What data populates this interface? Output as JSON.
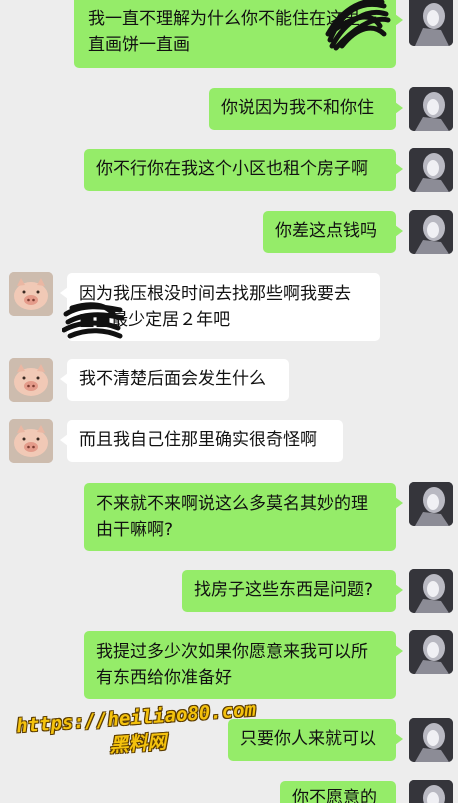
{
  "messages": [
    {
      "side": "me",
      "text": "我一直不理解为什么你不能住在这里一直画饼一直画"
    },
    {
      "side": "me",
      "text": "你说因为我不和你住"
    },
    {
      "side": "me",
      "text": "你不行你在我这个小区也租个房子啊"
    },
    {
      "side": "me",
      "text": "你差这点钱吗"
    },
    {
      "side": "other",
      "text": "因为我压根没时间去找那些啊我要去■■最少定居２年吧"
    },
    {
      "side": "other",
      "text": "我不清楚后面会发生什么"
    },
    {
      "side": "other",
      "text": "而且我自己住那里确实很奇怪啊"
    },
    {
      "side": "me",
      "text": "不来就不来啊说这么多莫名其妙的理由干嘛啊?"
    },
    {
      "side": "me",
      "text": "找房子这些东西是问题?"
    },
    {
      "side": "me",
      "text": "我提过多少次如果你愿意来我可以所有东西给你准备好"
    },
    {
      "side": "me",
      "text": "只要你人来就可以"
    },
    {
      "side": "me",
      "text": "你不愿意的"
    }
  ],
  "watermark": {
    "url": "https://heiliao80.com",
    "label": "黑料网"
  },
  "colors": {
    "green": "#95ec69",
    "white": "#ffffff",
    "background": "#ededed"
  }
}
